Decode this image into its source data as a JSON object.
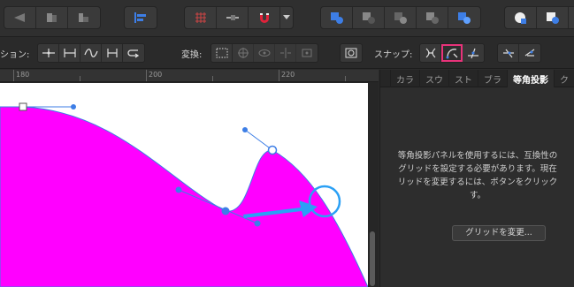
{
  "toolbar": {
    "icons": [
      "send-back-icon",
      "bring-front-icon",
      "move-icon",
      "align-icon",
      "grid-icon",
      "guides-icon",
      "snapping-magnet-icon",
      "snapping-dropdown-icon",
      "boolean-add-icon",
      "boolean-subtract-icon",
      "boolean-intersect-icon",
      "boolean-xor-icon",
      "boolean-divide-icon",
      "shape-icon-1",
      "shape-icon-2",
      "shape-icon-3"
    ]
  },
  "context": {
    "action_label": "ション:",
    "transform_label": "変換:",
    "snap_label": "スナップ:"
  },
  "ruler": {
    "labels": [
      "180",
      "200",
      "220"
    ]
  },
  "panel": {
    "tabs": [
      "カラ",
      "スウ",
      "スト",
      "ブラ",
      "等角投影",
      "ク"
    ],
    "active_tab": "等角投影",
    "message": "等角投影パネルを使用するには、互換性の\nグリッドを設定する必要があります。現在\nリッドを変更するには、ボタンをクリック\nす。",
    "button_label": "グリッドを変更..."
  },
  "colors": {
    "fill": "#ff00ff",
    "curve": "#3d7ee6",
    "highlight": "#e8337a"
  }
}
